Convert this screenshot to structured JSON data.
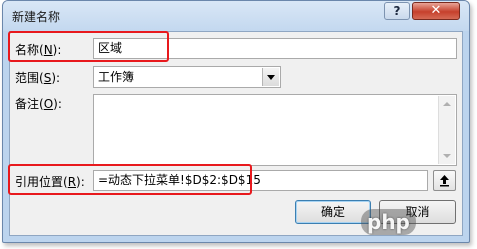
{
  "window": {
    "title": "新建名称",
    "help_label": "?",
    "close_label": "✕"
  },
  "form": {
    "name": {
      "label_prefix": "名称(",
      "accesskey": "N",
      "label_suffix": "):",
      "value": "区域"
    },
    "scope": {
      "label_prefix": "范围(",
      "accesskey": "S",
      "label_suffix": "):",
      "value": "工作簿"
    },
    "comment": {
      "label_prefix": "备注(",
      "accesskey": "O",
      "label_suffix": "):",
      "value": ""
    },
    "refers_to": {
      "label_prefix": "引用位置(",
      "accesskey": "R",
      "label_suffix": "):",
      "value": "=动态下拉菜单!$D$2:$D$15"
    }
  },
  "buttons": {
    "ok": "确定",
    "cancel": "取消"
  },
  "watermark": "php",
  "colors": {
    "highlight": "#e8191d",
    "title_bar": "#c3d8ef"
  }
}
